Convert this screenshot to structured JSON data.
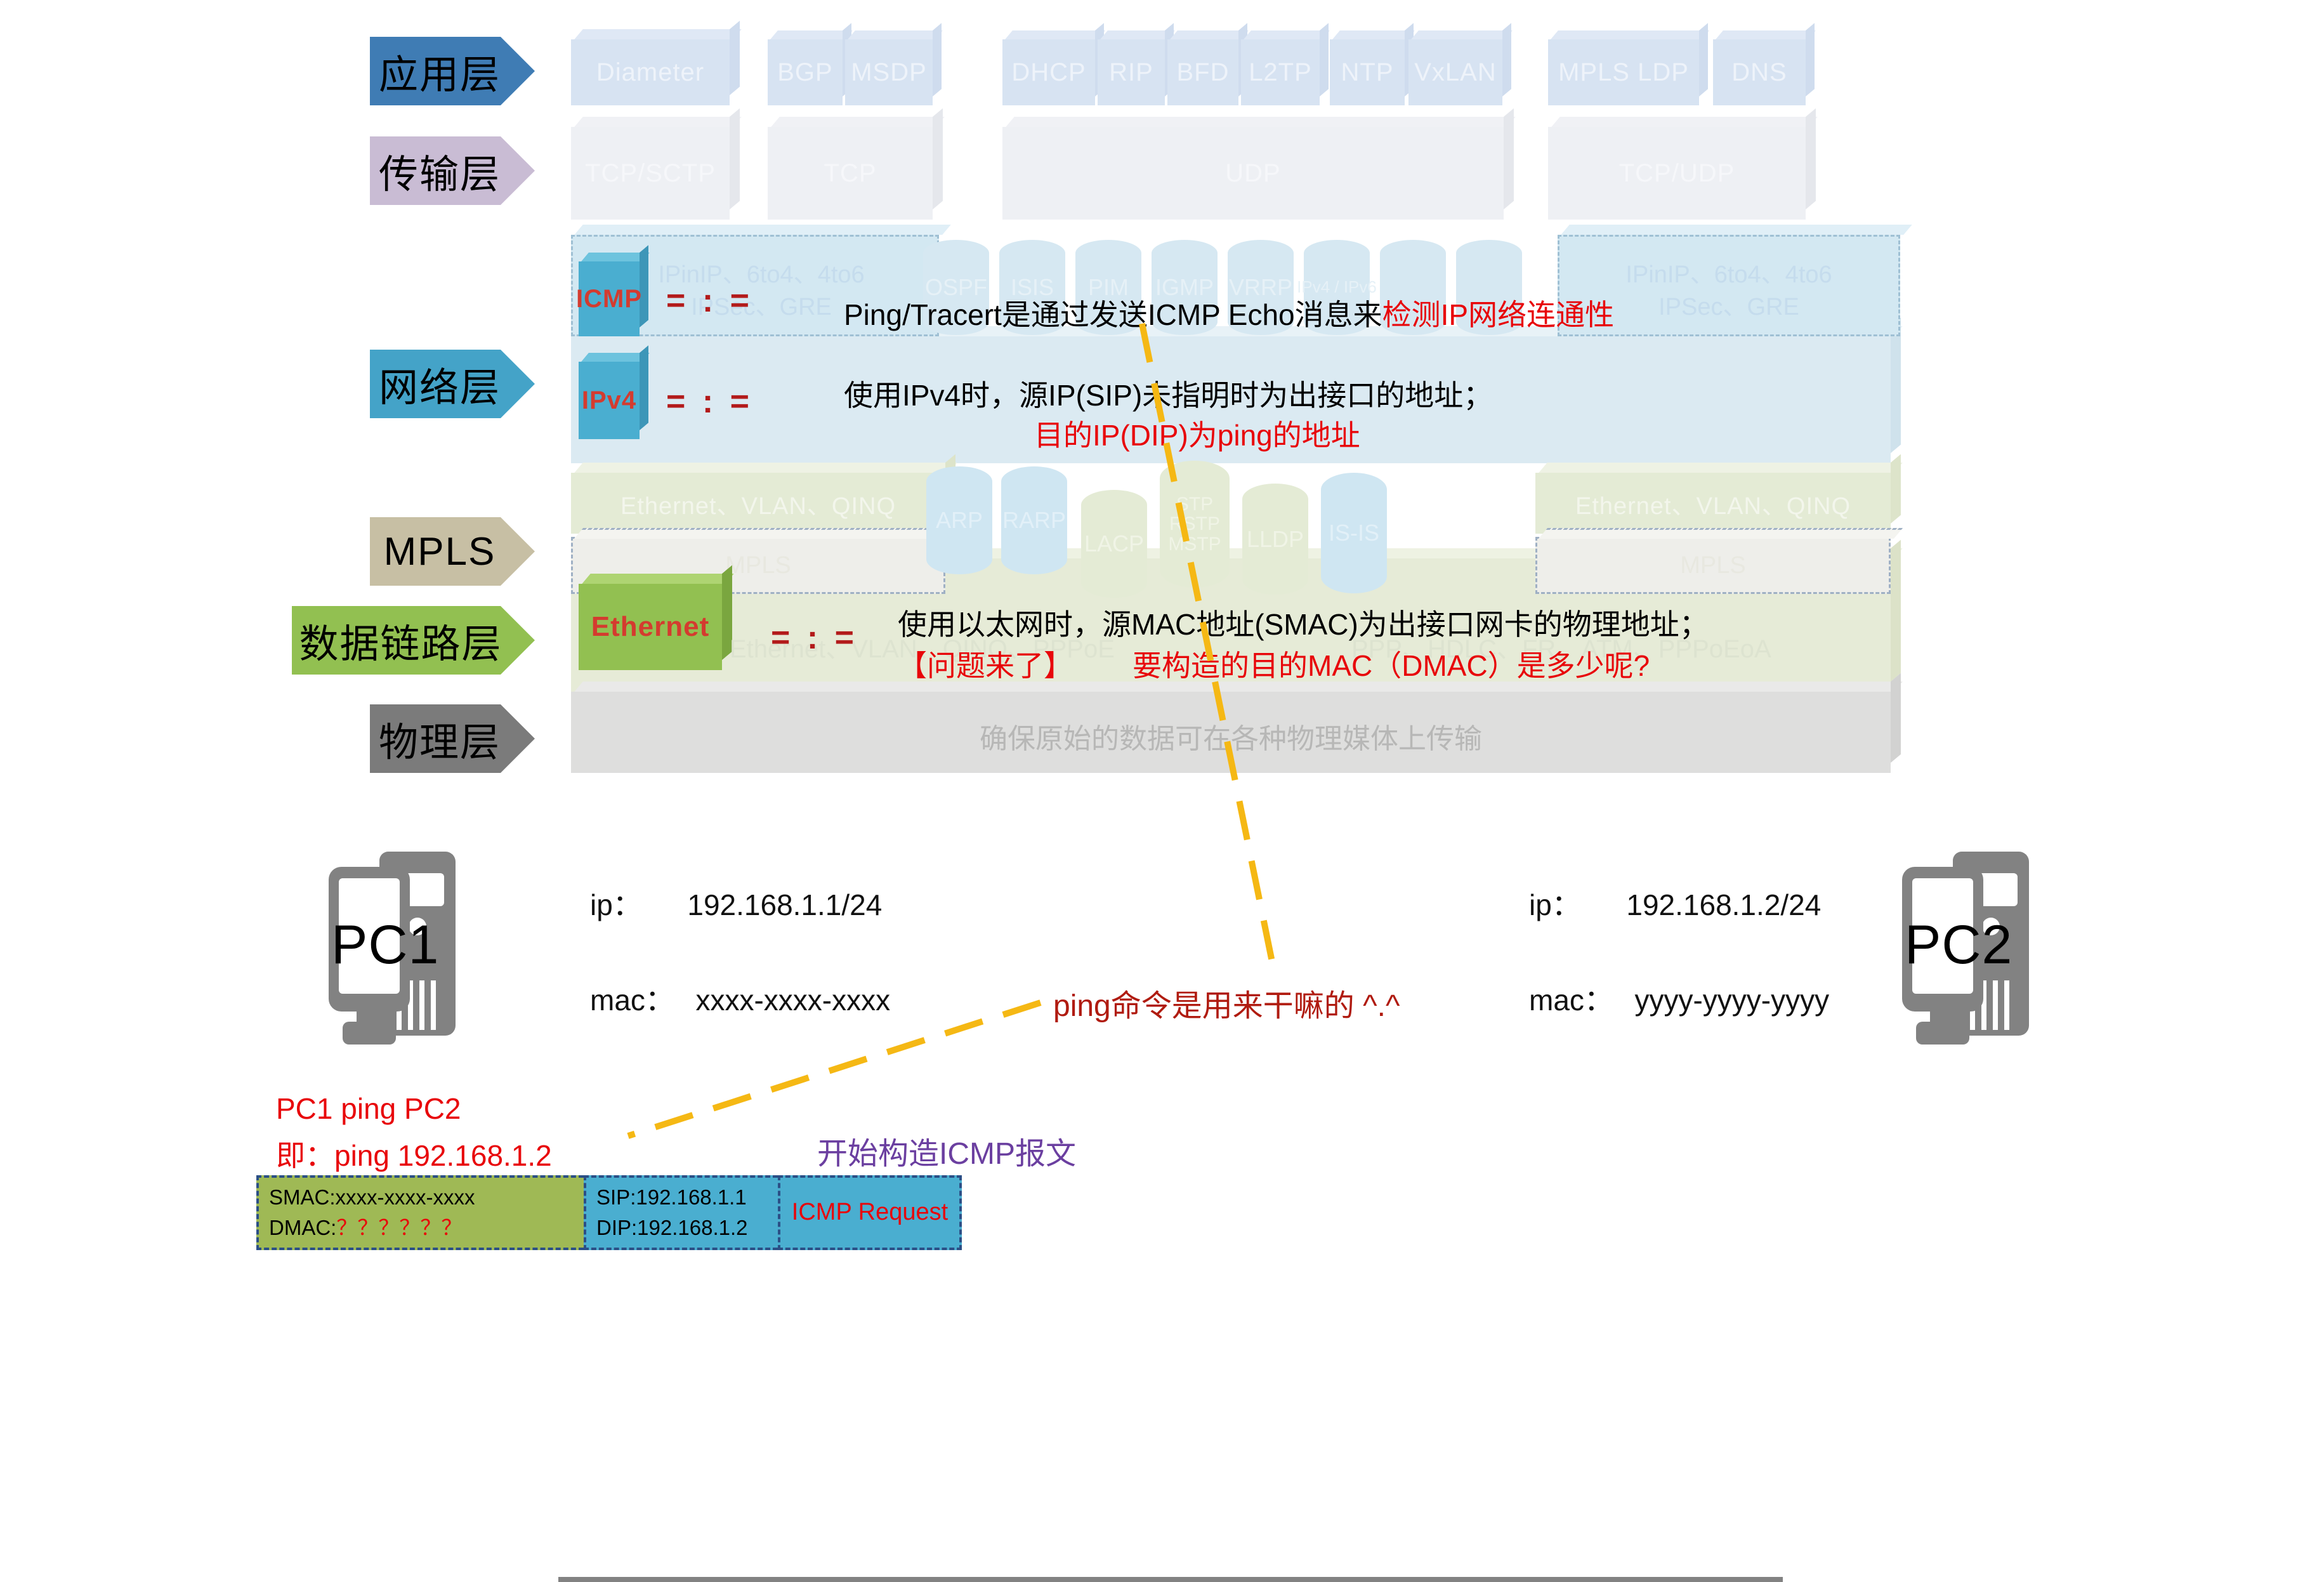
{
  "layers": [
    {
      "id": "application",
      "label": "应用层",
      "color": "#3f7cb4",
      "text_color": "#000000"
    },
    {
      "id": "transport",
      "label": "传输层",
      "color": "#c9bcd4",
      "text_color": "#000000"
    },
    {
      "id": "network",
      "label": "网络层",
      "color": "#44a3c8",
      "text_color": "#000000"
    },
    {
      "id": "mpls",
      "label": "MPLS",
      "color": "#c7bfa4",
      "text_color": "#000000"
    },
    {
      "id": "datalink",
      "label": "数据链路层",
      "color": "#92c051",
      "text_color": "#000000"
    },
    {
      "id": "physical",
      "label": "物理层",
      "color": "#7b7b7b",
      "text_color": "#000000"
    }
  ],
  "application_protocols": [
    {
      "label": "Diameter"
    },
    {
      "label": "BGP"
    },
    {
      "label": "MSDP"
    },
    {
      "label": "DHCP"
    },
    {
      "label": "RIP"
    },
    {
      "label": "BFD"
    },
    {
      "label": "L2TP"
    },
    {
      "label": "NTP"
    },
    {
      "label": "VxLAN"
    },
    {
      "label": "MPLS LDP"
    },
    {
      "label": "DNS"
    }
  ],
  "transport_protocols": [
    {
      "label": "TCP/SCTP"
    },
    {
      "label": "TCP"
    },
    {
      "label": "UDP"
    },
    {
      "label": "TCP/UDP"
    }
  ],
  "network_layer": {
    "icmp_label": "ICMP",
    "ipv4_label": "IPv4",
    "eq_mark": "= : =",
    "tunnel_left": "IPinIP、6to4、4to6\nIPSec、GRE",
    "tunnel_right": "IPinIP、6to4、4to6\nIPSec、GRE",
    "cylinders": [
      "OSPF",
      "ISIS",
      "PIM",
      "IGMP",
      "VRRP",
      "IPv4 / IPv6"
    ],
    "note_1_black": "Ping/Tracert是通过发送ICMP Echo消息来",
    "note_1_red": "检测IP网络连通性",
    "note_2_black": "使用IPv4时，源IP(SIP)未指明时为出接口的地址；",
    "note_2_red": "目的IP(DIP)为ping的地址"
  },
  "mpls_layer": {
    "box_label": "MPLS"
  },
  "datalink_layer": {
    "ethernet_label": "Ethernet",
    "eq_mark": "= : =",
    "box_left_label": "Ethernet、VLAN、QINQ",
    "box_right_label": "Ethernet、VLAN、QINQ",
    "faded_inline": "Ethernet、VLAN、QINQ、PPPoE",
    "faded_inline_right": "PPP、HDLC、FR、ATM、PPPoEoA",
    "cylinders": [
      "ARP",
      "RARP",
      "LACP",
      "STP\nRSTP\nMSTP",
      "LLDP",
      "IS-IS"
    ],
    "note_black": "使用以太网时，源MAC地址(SMAC)为出接口网卡的物理地址；",
    "note_red_1": "【问题来了】",
    "note_red_2": "要构造的目的MAC（DMAC）是多少呢?"
  },
  "physical_layer": {
    "note": "确保原始的数据可在各种物理媒体上传输"
  },
  "network_diagram": {
    "pc1": {
      "name": "PC1",
      "ip_label": "ip：",
      "ip_value": "192.168.1.1/24",
      "mac_label": "mac：",
      "mac_value": "xxxx-xxxx-xxxx"
    },
    "pc2": {
      "name": "PC2",
      "ip_label": "ip：",
      "ip_value": "192.168.1.2/24",
      "mac_label": "mac：",
      "mac_value": "yyyy-yyyy-yyyy"
    },
    "ping_question": "ping命令是用来干嘛的 ^.^"
  },
  "bottom": {
    "ping_line1": "PC1 ping PC2",
    "ping_line2": "即：ping 192.168.1.2",
    "construct_note": "开始构造ICMP报文",
    "packet": {
      "ethernet": {
        "smac_label": "SMAC:",
        "smac_value": "xxxx-xxxx-xxxx",
        "dmac_label": "DMAC:",
        "dmac_value": "？？？？？？",
        "color": "#9fb955"
      },
      "ip": {
        "sip": "SIP:192.168.1.1",
        "dip": "DIP:192.168.1.2",
        "color": "#4aaed0"
      },
      "icmp": {
        "label": "ICMP Request",
        "color": "#4aaed0",
        "text_color": "#e8060a"
      }
    }
  },
  "colors": {
    "accent_red": "#e8060a",
    "dark_red": "#b01b10",
    "purple": "#6b3fa0",
    "arrow_yellow": "#f5b814",
    "app_blue": "#3f7cb4",
    "transport_lilac": "#c9bcd4",
    "network_cyan": "#44a3c8",
    "mpls_tan": "#c7bfa4",
    "datalink_green": "#92c051",
    "physical_gray": "#7b7b7b"
  }
}
